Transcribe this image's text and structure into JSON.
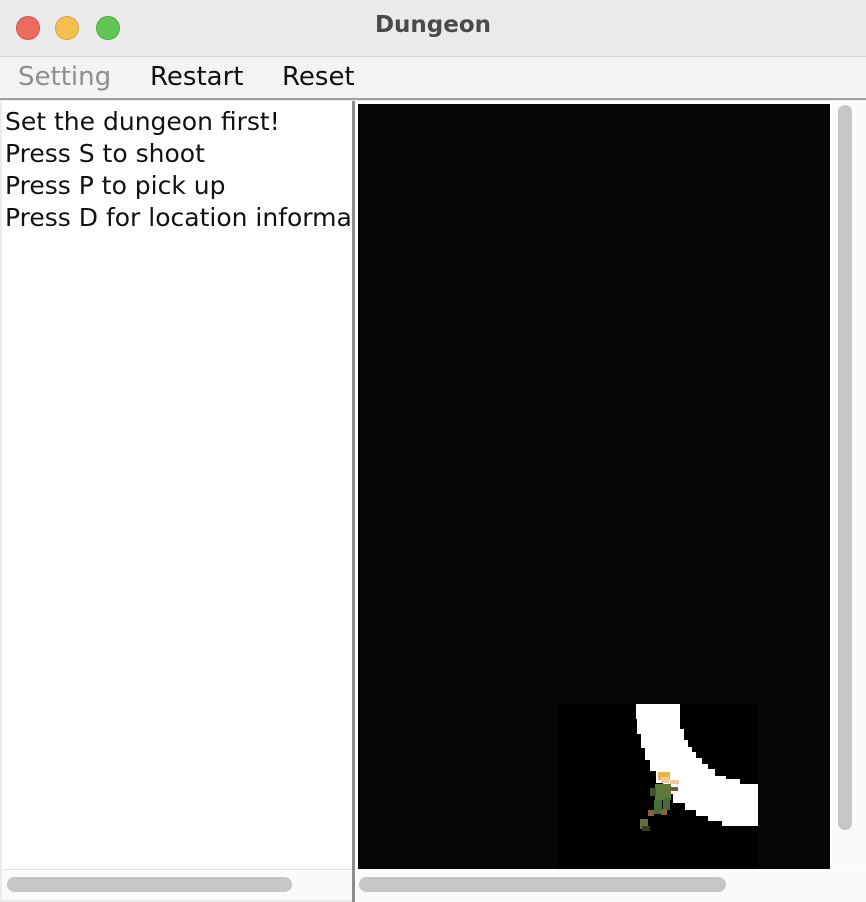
{
  "window": {
    "title": "Dungeon"
  },
  "menubar": {
    "items": [
      {
        "label": "Setting",
        "enabled": false
      },
      {
        "label": "Restart",
        "enabled": true
      },
      {
        "label": "Reset",
        "enabled": true
      }
    ]
  },
  "info_panel": {
    "lines": [
      "Set the dungeon first!",
      "Press S to shoot",
      "Press P to pick up",
      "Press D for location informa"
    ]
  },
  "game_view": {
    "background_color": "#050505",
    "room_color": "#000000",
    "tunnel_color": "#ffffff",
    "player_icon": "player-sprite-icon"
  },
  "colors": {
    "close": "#ed6a5e",
    "minimize": "#f5bf4f",
    "maximize": "#61c554"
  }
}
